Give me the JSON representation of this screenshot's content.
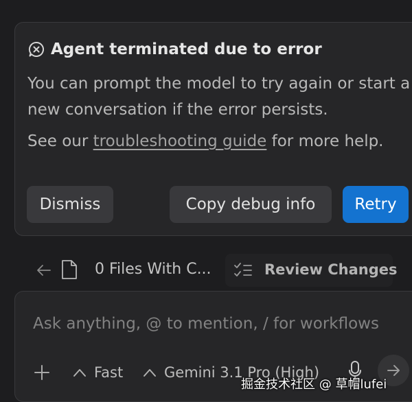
{
  "error_card": {
    "icon": "x-circle-chat-icon",
    "title": "Agent terminated due to error",
    "description": "You can prompt the model to try again or start a new conversation if the error persists.",
    "help_prefix": "See our ",
    "help_link": "troubleshooting guide",
    "help_suffix": " for more help.",
    "buttons": {
      "dismiss": "Dismiss",
      "copy_debug": "Copy debug info",
      "retry": "Retry"
    }
  },
  "changes_bar": {
    "files_label": "0 Files With C...",
    "review_label": "Review Changes"
  },
  "chat_input": {
    "placeholder": "Ask anything, @ to mention, / for workflows",
    "mode": "Fast",
    "model": "Gemini 3.1 Pro (High)"
  },
  "watermark": "掘金技术社区 @ 草帽lufei",
  "colors": {
    "background": "#1d1d1f",
    "card": "#262628",
    "button": "#39393c",
    "accent": "#1473d0"
  }
}
